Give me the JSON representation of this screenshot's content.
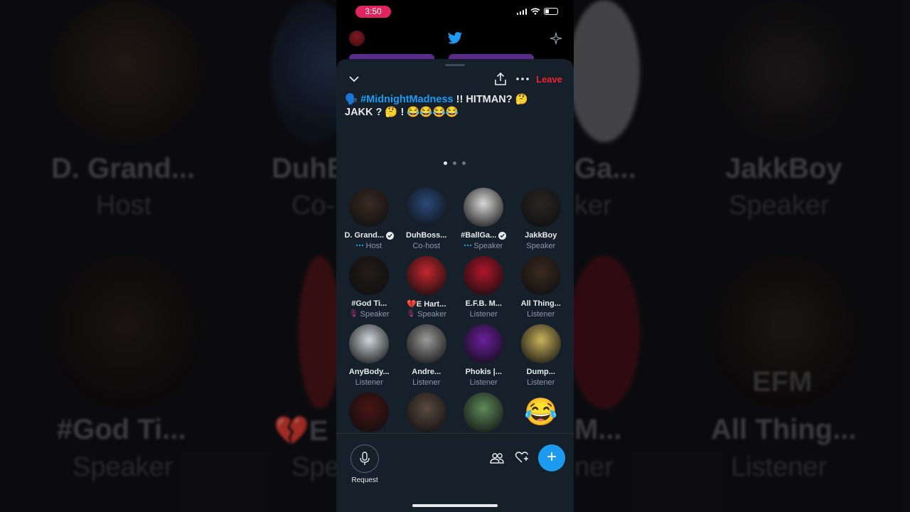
{
  "status_bar": {
    "time": "3:50"
  },
  "space": {
    "title_emoji": "🗣️",
    "title_hashtag": "#MidnightMadness",
    "title_rest": " !! HITMAN? 🤔 JAKK ? 🤔 ! 😂😂😂😂",
    "leave_label": "Leave"
  },
  "participants": [
    {
      "name": "D. Grand...",
      "role": "Host",
      "verified": true,
      "wave": true,
      "micoff": false,
      "avatar_color": "#3a2b22"
    },
    {
      "name": "DuhBoss...",
      "role": "Co-host",
      "verified": false,
      "wave": false,
      "micoff": false,
      "avatar_color": "#2b4a78"
    },
    {
      "name": "#BallGa...",
      "role": "Speaker",
      "verified": true,
      "wave": true,
      "micoff": false,
      "avatar_color": "#d8d8d8"
    },
    {
      "name": "JakkBoy",
      "role": "Speaker",
      "verified": false,
      "wave": false,
      "micoff": false,
      "avatar_color": "#2a2624"
    },
    {
      "name": "#God Ti...",
      "role": "Speaker",
      "verified": false,
      "wave": false,
      "micoff": true,
      "avatar_color": "#241c18"
    },
    {
      "name": "💔E Hart...",
      "role": "Speaker",
      "verified": false,
      "wave": false,
      "micoff": true,
      "avatar_color": "#c3262e"
    },
    {
      "name": "E.F.B. M...",
      "role": "Listener",
      "verified": false,
      "wave": false,
      "micoff": false,
      "avatar_color": "#b1162a"
    },
    {
      "name": "All Thing...",
      "role": "Listener",
      "verified": false,
      "wave": false,
      "micoff": false,
      "avatar_color": "#3a2a1e"
    },
    {
      "name": "AnyBody...",
      "role": "Listener",
      "verified": false,
      "wave": false,
      "micoff": false,
      "avatar_color": "#cfd6da"
    },
    {
      "name": "Andre...",
      "role": "Listener",
      "verified": false,
      "wave": false,
      "micoff": false,
      "avatar_color": "#9a9a9a"
    },
    {
      "name": "Phokis |...",
      "role": "Listener",
      "verified": false,
      "wave": false,
      "micoff": false,
      "avatar_color": "#6b1f9c"
    },
    {
      "name": "Dump...",
      "role": "Listener",
      "verified": false,
      "wave": false,
      "micoff": false,
      "avatar_color": "#c9b15a"
    },
    {
      "name": "",
      "role": "",
      "verified": false,
      "wave": false,
      "micoff": false,
      "avatar_color": "#4a1414"
    },
    {
      "name": "",
      "role": "",
      "verified": false,
      "wave": false,
      "micoff": false,
      "avatar_color": "#5b4a3e"
    },
    {
      "name": "",
      "role": "",
      "verified": false,
      "wave": false,
      "micoff": false,
      "avatar_color": "#5f8a5a"
    },
    {
      "name": "",
      "role": "",
      "verified": false,
      "wave": false,
      "micoff": false,
      "emoji": "😂"
    }
  ],
  "footer": {
    "request_label": "Request",
    "fab_label": "+"
  },
  "background": {
    "names": [
      "D. Grand...",
      "DuhB",
      "Ga...",
      "JakkBoy",
      "#God Ti...",
      "💔E",
      "M...",
      "All Thing..."
    ],
    "roles": [
      "Host",
      "Co-",
      "ker",
      "Speaker",
      "Speaker",
      "Spe",
      "ner",
      "Listener"
    ],
    "efm_text": "EFM"
  },
  "colors": {
    "accent": "#1d9bf0",
    "leave": "#f4212e",
    "sheet": "#15202b",
    "time_pill": "#e0245e"
  }
}
